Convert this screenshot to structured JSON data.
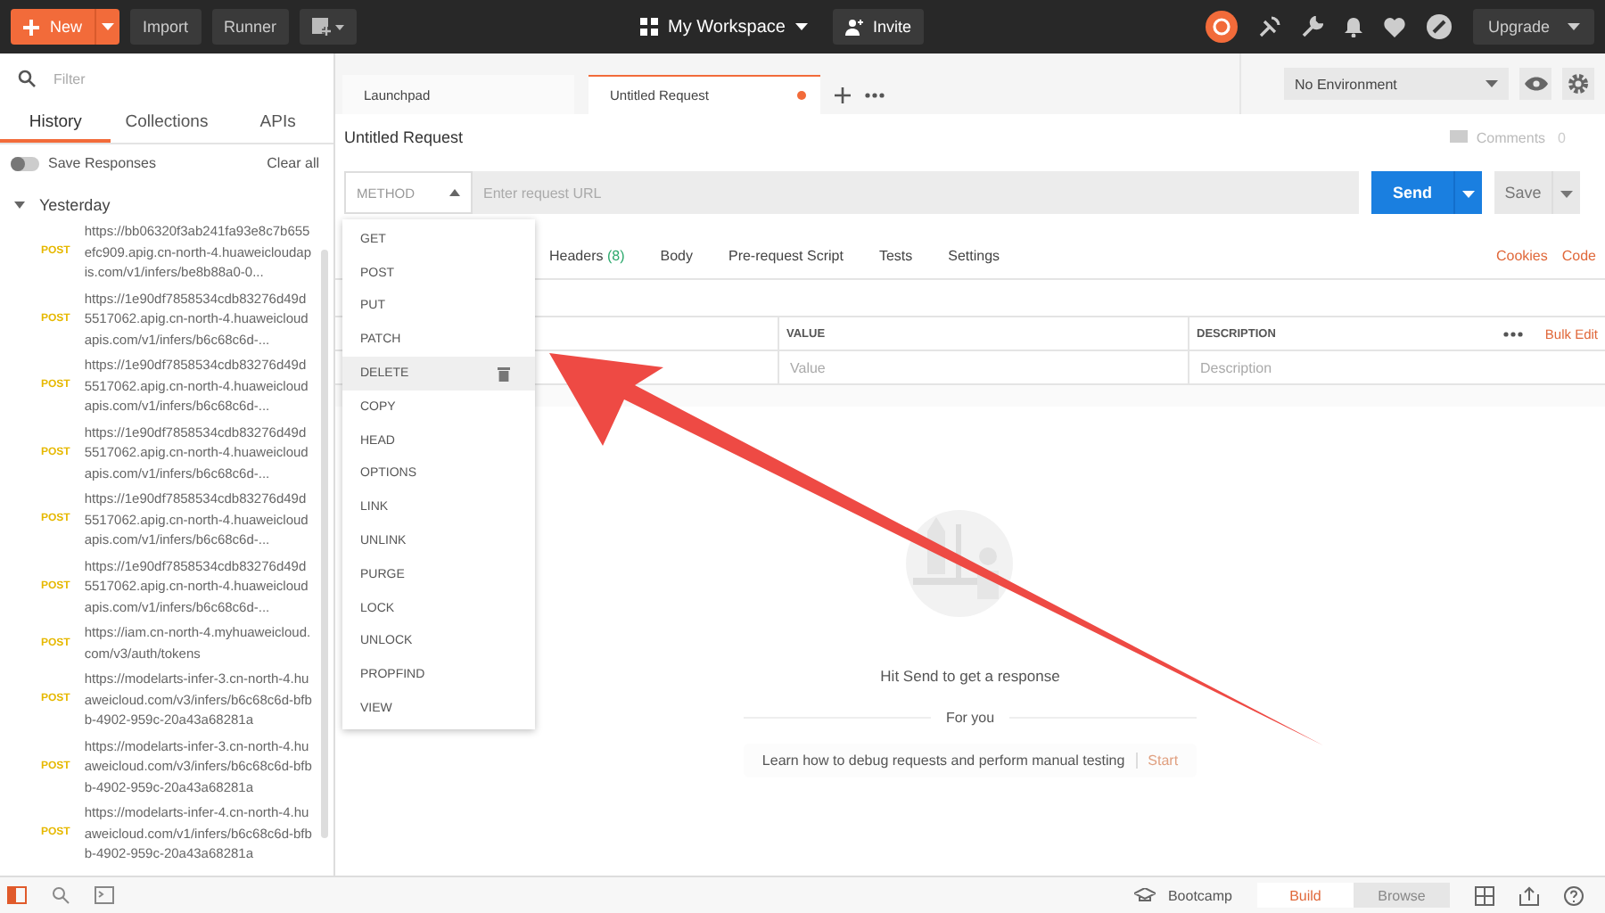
{
  "toolbar": {
    "new_button": "New",
    "buttons": [
      "Import",
      "Runner"
    ],
    "workspace": "My Workspace",
    "invite": "Invite",
    "upgrade": "Upgrade"
  },
  "sidebar": {
    "filter_placeholder": "Filter",
    "tabs": [
      {
        "label": "History",
        "selected": true
      },
      {
        "label": "Collections",
        "selected": false
      },
      {
        "label": "APIs",
        "selected": false
      }
    ],
    "save_responses": {
      "label": "Save Responses",
      "on": false
    },
    "clear_all": "Clear all",
    "group": {
      "label": "Yesterday",
      "expanded": true,
      "items": [
        {
          "method": "POST",
          "url": "https://bb06320f3ab241fa93e8c7b655efc909.apig.cn-north-4.huaweicloudapis.com/v1/infers/be8b88a0-0..."
        },
        {
          "method": "POST",
          "url": "https://1e90df7858534cdb83276d49d5517062.apig.cn-north-4.huaweicloudapis.com/v1/infers/b6c68c6d-..."
        },
        {
          "method": "POST",
          "url": "https://1e90df7858534cdb83276d49d5517062.apig.cn-north-4.huaweicloudapis.com/v1/infers/b6c68c6d-..."
        },
        {
          "method": "POST",
          "url": "https://1e90df7858534cdb83276d49d5517062.apig.cn-north-4.huaweicloudapis.com/v1/infers/b6c68c6d-..."
        },
        {
          "method": "POST",
          "url": "https://1e90df7858534cdb83276d49d5517062.apig.cn-north-4.huaweicloudapis.com/v1/infers/b6c68c6d-..."
        },
        {
          "method": "POST",
          "url": "https://1e90df7858534cdb83276d49d5517062.apig.cn-north-4.huaweicloudapis.com/v1/infers/b6c68c6d-..."
        },
        {
          "method": "POST",
          "url": "https://iam.cn-north-4.myhuaweicloud.com/v3/auth/tokens"
        },
        {
          "method": "POST",
          "url": "https://modelarts-infer-3.cn-north-4.huaweicloud.com/v3/infers/b6c68c6d-bfbb-4902-959c-20a43a68281a"
        },
        {
          "method": "POST",
          "url": "https://modelarts-infer-3.cn-north-4.huaweicloud.com/v3/infers/b6c68c6d-bfbb-4902-959c-20a43a68281a"
        },
        {
          "method": "POST",
          "url": "https://modelarts-infer-4.cn-north-4.huaweicloud.com/v1/infers/b6c68c6d-bfbb-4902-959c-20a43a68281a"
        }
      ]
    }
  },
  "request_tabs": [
    {
      "label": "Launchpad",
      "selected": false,
      "unsaved": false
    },
    {
      "label": "Untitled Request",
      "selected": true,
      "unsaved": true
    }
  ],
  "environment": "No Environment",
  "request": {
    "title": "Untitled Request",
    "comments": "Comments",
    "comments_count": "0",
    "method_placeholder": "METHOD",
    "url_placeholder": "Enter request URL",
    "send": "Send",
    "save": "Save"
  },
  "method_menu": [
    {
      "label": "GET",
      "highlighted": false
    },
    {
      "label": "POST",
      "highlighted": false
    },
    {
      "label": "PUT",
      "highlighted": false
    },
    {
      "label": "PATCH",
      "highlighted": false
    },
    {
      "label": "DELETE",
      "highlighted": true
    },
    {
      "label": "COPY",
      "highlighted": false
    },
    {
      "label": "HEAD",
      "highlighted": false
    },
    {
      "label": "OPTIONS",
      "highlighted": false
    },
    {
      "label": "LINK",
      "highlighted": false
    },
    {
      "label": "UNLINK",
      "highlighted": false
    },
    {
      "label": "PURGE",
      "highlighted": false
    },
    {
      "label": "LOCK",
      "highlighted": false
    },
    {
      "label": "UNLOCK",
      "highlighted": false
    },
    {
      "label": "PROPFIND",
      "highlighted": false
    },
    {
      "label": "VIEW",
      "highlighted": false
    }
  ],
  "section_tabs": [
    {
      "label": "Headers",
      "count": "(8)"
    },
    {
      "label": "Body"
    },
    {
      "label": "Pre-request Script"
    },
    {
      "label": "Tests"
    },
    {
      "label": "Settings"
    }
  ],
  "links": [
    "Cookies",
    "Code"
  ],
  "params_table": {
    "columns": [
      "VALUE",
      "DESCRIPTION"
    ],
    "bulk_edit": "Bulk Edit",
    "placeholders": [
      "Value",
      "Description"
    ]
  },
  "response": {
    "message": "Hit Send to get a response",
    "for_you": "For you",
    "tip": "Learn how to debug requests and perform manual testing",
    "start": "Start"
  },
  "status_bar": {
    "bootcamp": "Bootcamp",
    "modes": [
      {
        "label": "Build",
        "selected": true
      },
      {
        "label": "Browse",
        "selected": false
      }
    ]
  }
}
